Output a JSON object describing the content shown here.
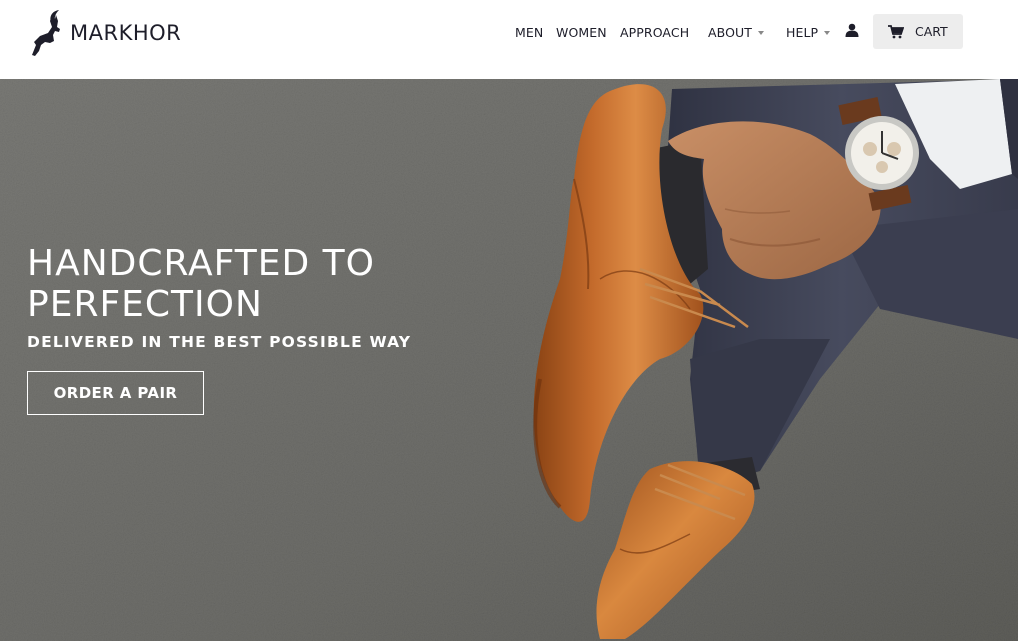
{
  "brand": {
    "name": "MARKHOR"
  },
  "nav": {
    "items": [
      {
        "label": "MEN"
      },
      {
        "label": "WOMEN"
      },
      {
        "label": "APPROACH"
      },
      {
        "label": "ABOUT"
      },
      {
        "label": "HELP"
      }
    ],
    "cart_label": "CART"
  },
  "hero": {
    "title": "HANDCRAFTED TO PERFECTION",
    "subtitle": "DELIVERED IN THE BEST POSSIBLE WAY",
    "cta_label": "ORDER A PAIR"
  },
  "colors": {
    "header_bg": "#ffffff",
    "text_dark": "#1e1e2a",
    "cart_bg": "#ededed",
    "carpet": "#6f6f6b",
    "leather": "#b8642a",
    "trousers": "#3f4355"
  },
  "icons": [
    "markhor-logo-icon",
    "user-icon",
    "cart-icon",
    "chevron-down-icon"
  ]
}
